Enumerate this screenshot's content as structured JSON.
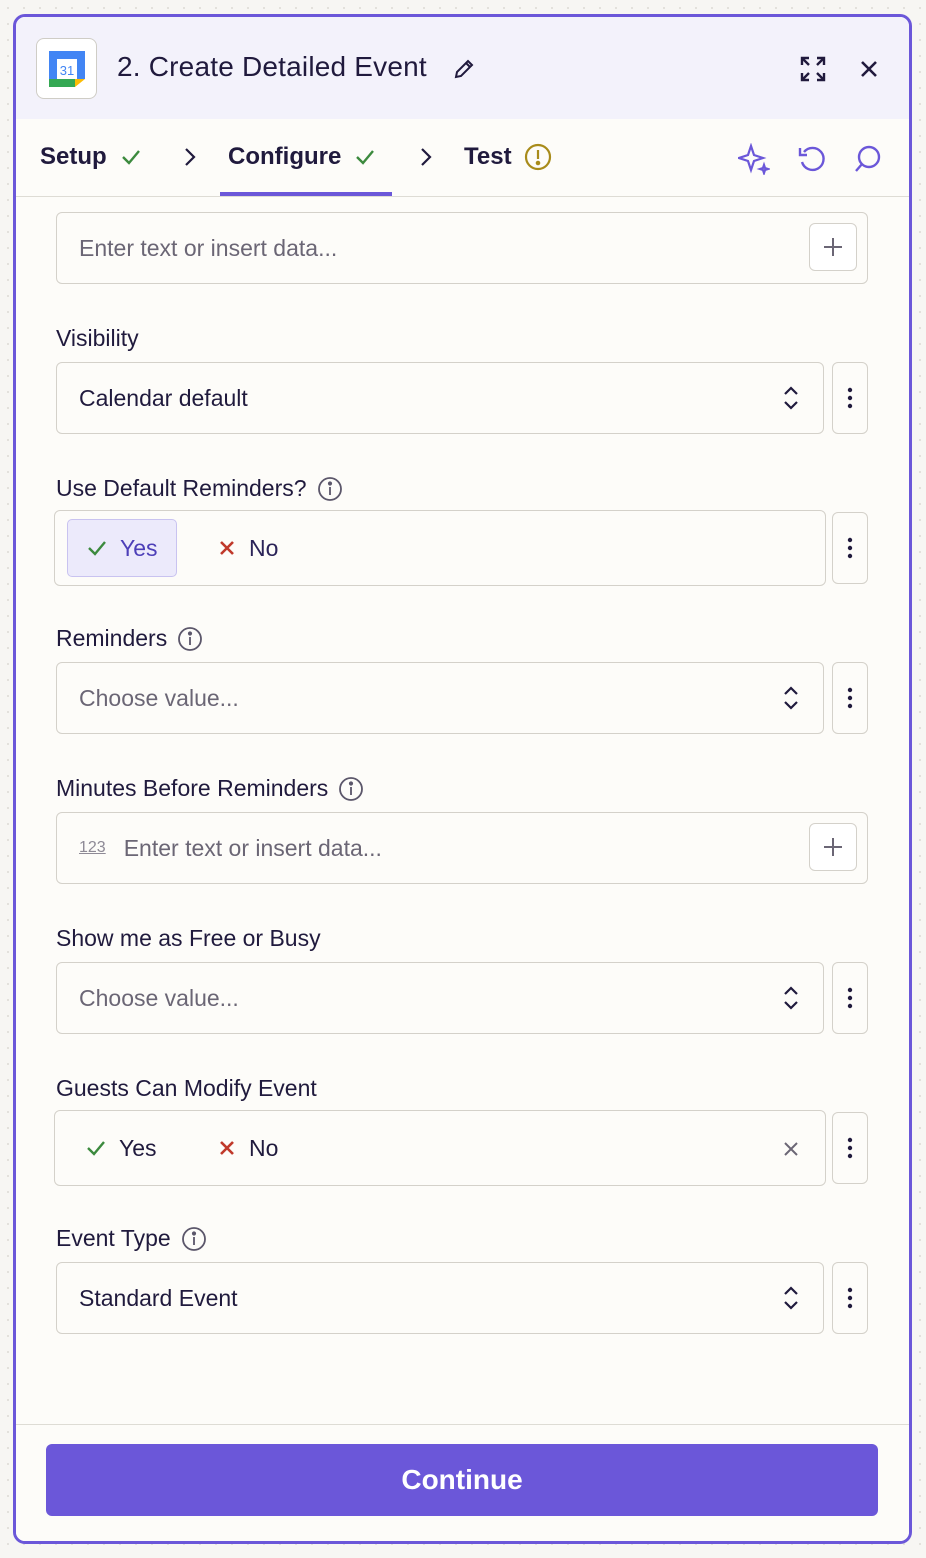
{
  "header": {
    "app_icon_text": "31",
    "title": "2. Create Detailed Event"
  },
  "tabs": [
    {
      "label": "Setup",
      "status": "complete"
    },
    {
      "label": "Configure",
      "status": "complete"
    },
    {
      "label": "Test",
      "status": "warning"
    }
  ],
  "fields": {
    "top_text": {
      "placeholder": "Enter text or insert data..."
    },
    "visibility": {
      "label": "Visibility",
      "value": "Calendar default"
    },
    "default_reminders": {
      "label": "Use Default Reminders?",
      "yes": "Yes",
      "no": "No",
      "selected": "Yes"
    },
    "reminders": {
      "label": "Reminders",
      "placeholder": "Choose value..."
    },
    "minutes_before": {
      "label": "Minutes Before Reminders",
      "prefix": "123",
      "placeholder": "Enter text or insert data..."
    },
    "free_busy": {
      "label": "Show me as Free or Busy",
      "placeholder": "Choose value..."
    },
    "guests_modify": {
      "label": "Guests Can Modify Event",
      "yes": "Yes",
      "no": "No"
    },
    "event_type": {
      "label": "Event Type",
      "value": "Standard Event"
    }
  },
  "footer": {
    "continue_label": "Continue"
  },
  "colors": {
    "accent": "#6b57d9",
    "success": "#3c8a3e",
    "warning": "#a88b1a",
    "danger": "#c0392b"
  }
}
